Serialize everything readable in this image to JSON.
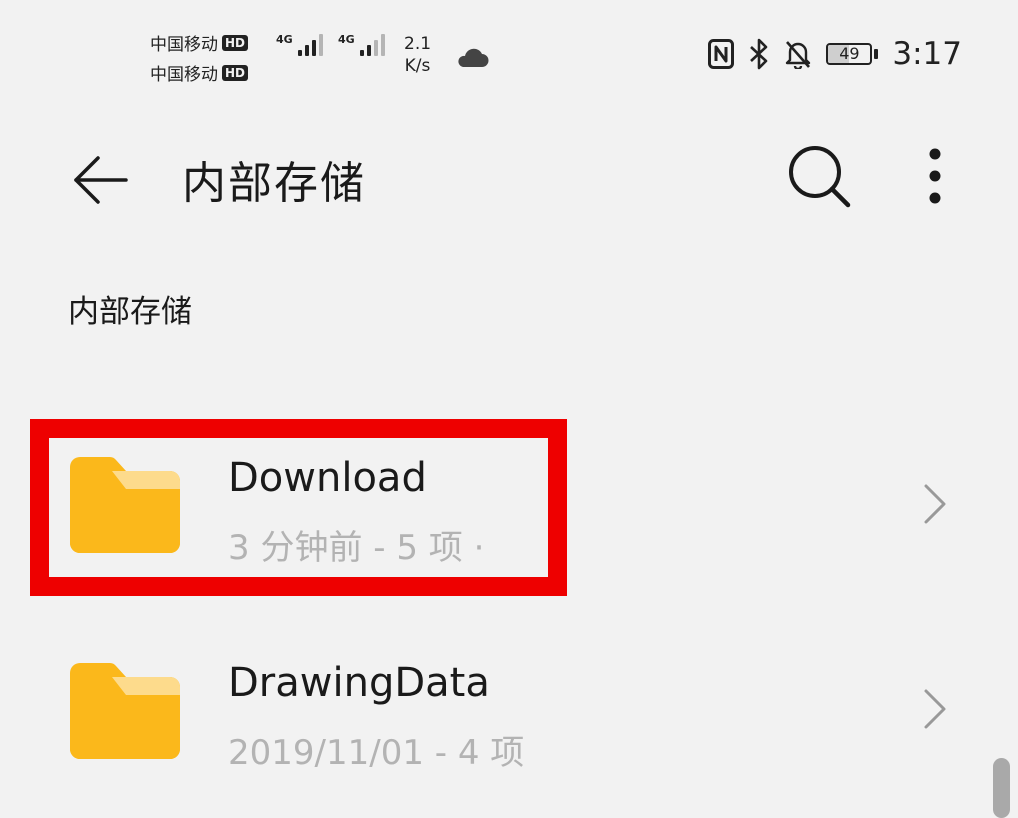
{
  "status_bar": {
    "carrier_1": "中国移动",
    "carrier_2": "中国移动",
    "hd_label": "HD",
    "network_1": "4G",
    "network_2": "4G",
    "speed_value": "2.1",
    "speed_unit": "K/s",
    "battery_percent": "49",
    "battery_level": 0.49,
    "time": "3:17",
    "icons": [
      "cloud-icon",
      "nfc-icon",
      "bluetooth-icon",
      "bell-muted-icon",
      "battery-icon"
    ]
  },
  "app_bar": {
    "title": "内部存储",
    "icons": [
      "back-arrow-icon",
      "search-icon",
      "more-vertical-icon"
    ]
  },
  "breadcrumb": {
    "path": "内部存储"
  },
  "folders": [
    {
      "name": "Download",
      "meta": "3 分钟前 - 5 项 ·",
      "icon": "folder-icon",
      "highlighted": true
    },
    {
      "name": "DrawingData",
      "meta": "2019/11/01 - 4 项",
      "icon": "folder-icon",
      "highlighted": false
    }
  ],
  "colors": {
    "background": "#f2f2f2",
    "folder_primary": "#fbb81b",
    "folder_tab_light": "#fddb8c",
    "highlight": "#ee0000",
    "meta_text": "#b3b3b3"
  }
}
